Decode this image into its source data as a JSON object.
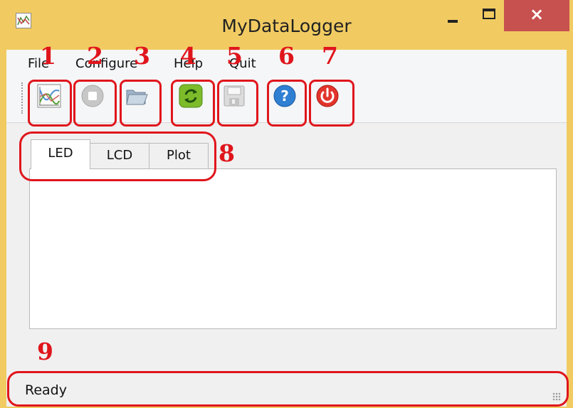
{
  "window": {
    "title": "MyDataLogger",
    "close_symbol": "×"
  },
  "menu": [
    {
      "label": "File"
    },
    {
      "label": "Configure"
    },
    {
      "label": "Help"
    },
    {
      "label": "Quit"
    }
  ],
  "toolbar": [
    {
      "name": "plot-tool-button",
      "icon": "chart-icon"
    },
    {
      "name": "stop-tool-button",
      "icon": "stop-icon"
    },
    {
      "name": "open-tool-button",
      "icon": "folder-icon"
    },
    {
      "name": "refresh-tool-button",
      "icon": "refresh-icon"
    },
    {
      "name": "save-tool-button",
      "icon": "save-icon"
    },
    {
      "name": "help-tool-button",
      "icon": "help-icon"
    },
    {
      "name": "power-tool-button",
      "icon": "power-icon"
    }
  ],
  "tabs": [
    {
      "label": "LED",
      "selected": true
    },
    {
      "label": "LCD",
      "selected": false
    },
    {
      "label": "Plot",
      "selected": false
    }
  ],
  "annotations": [
    "1",
    "2",
    "3",
    "4",
    "5",
    "6",
    "7",
    "8",
    "9"
  ],
  "status": {
    "text": "Ready"
  },
  "colors": {
    "accent": "#e0151c",
    "frame": "#f1cb62",
    "close": "#c7514f"
  }
}
